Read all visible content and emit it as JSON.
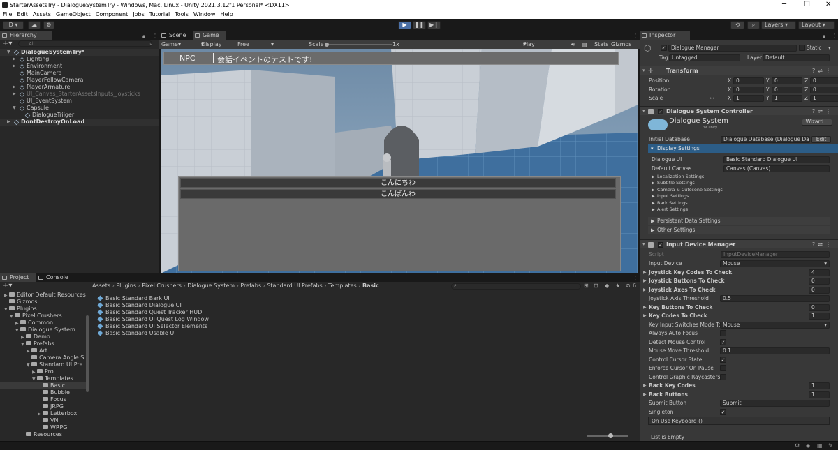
{
  "window": {
    "title": "StarterAssetsTry - DialogueSystemTry - Windows, Mac, Linux - Unity 2021.3.12f1 Personal* <DX11>",
    "minimize": "─",
    "maximize": "☐",
    "close": "✕"
  },
  "menu": [
    "File",
    "Edit",
    "Assets",
    "GameObject",
    "Component",
    "Jobs",
    "Tutorial",
    "Tools",
    "Window",
    "Help"
  ],
  "toolbar": {
    "account": "D ▾",
    "layers": "Layers",
    "layout": "Layout",
    "play": "▶",
    "pause": "❚❚",
    "step": "▶❙"
  },
  "hierarchy": {
    "tab": "Hierarchy",
    "search_placeholder": "All",
    "items": [
      {
        "label": "DialogueSystemTry*",
        "depth": 0,
        "type": "scene",
        "expanded": true
      },
      {
        "label": "Lighting",
        "depth": 1,
        "arrow": true
      },
      {
        "label": "Environment",
        "depth": 1,
        "arrow": true
      },
      {
        "label": "MainCamera",
        "depth": 1,
        "arrow": false
      },
      {
        "label": "PlayerFollowCamera",
        "depth": 1,
        "arrow": false
      },
      {
        "label": "PlayerArmature",
        "depth": 1,
        "arrow": true
      },
      {
        "label": "UI_Canvas_StarterAssetsInputs_Joysticks",
        "depth": 1,
        "arrow": true,
        "dim": true
      },
      {
        "label": "UI_EventSystem",
        "depth": 1,
        "arrow": false
      },
      {
        "label": "Capsule",
        "depth": 1,
        "arrow": true,
        "expanded": true
      },
      {
        "label": "DialogueTriiger",
        "depth": 2,
        "arrow": false
      },
      {
        "label": "DontDestroyOnLoad",
        "depth": 0,
        "type": "scene",
        "arrow": true
      }
    ]
  },
  "game": {
    "tabs": [
      {
        "label": "Scene"
      },
      {
        "label": "Game",
        "active": true
      }
    ],
    "mode": "Game",
    "display": "Display 1",
    "aspect": "Free Aspect",
    "scale_label": "Scale",
    "scale_value": "1x",
    "play_focused": "Play Focused",
    "stats": "Stats",
    "gizmos": "Gizmos",
    "subtitle_speaker": "NPC",
    "subtitle_text": "会話イベントのテストです!",
    "responses": [
      "こんにちわ",
      "こんばんわ"
    ]
  },
  "inspector": {
    "tab": "Inspector",
    "object_name": "Dialogue Manager",
    "static_label": "Static",
    "tag_label": "Tag",
    "tag_value": "Untagged",
    "layer_label": "Layer",
    "layer_value": "Default",
    "transform": {
      "title": "Transform",
      "position_label": "Position",
      "position": [
        "0",
        "0",
        "0"
      ],
      "rotation_label": "Rotation",
      "rotation": [
        "0",
        "0",
        "0"
      ],
      "scale_label": "Scale",
      "scale": [
        "1",
        "1",
        "1"
      ],
      "axes": [
        "X",
        "Y",
        "Z"
      ]
    },
    "dsc": {
      "title": "Dialogue System Controller",
      "logo_text": "Dialogue System",
      "logo_sub": "for unity",
      "wizard": "Wizard...",
      "initial_db_label": "Initial Database",
      "initial_db_value": "Dialogue Database (Dialogue Da",
      "edit": "Edit",
      "display_settings": "Display Settings",
      "dialogue_ui_label": "Dialogue UI",
      "dialogue_ui_value": "Basic Standard Dialogue UI",
      "default_canvas_label": "Default Canvas",
      "default_canvas_value": "Canvas (Canvas)",
      "subsections": [
        "Localization Settings",
        "Subtitle Settings",
        "Camera & Cutscene Settings",
        "Input Settings",
        "Bark Settings",
        "Alert Settings"
      ],
      "persistent": "Persistent Data Settings",
      "other": "Other Settings"
    },
    "idm": {
      "title": "Input Device Manager",
      "script_label": "Script",
      "script_value": "InputDeviceManager",
      "rows": [
        {
          "label": "Input Device",
          "value": "Mouse",
          "kind": "dropdown"
        },
        {
          "label": "Joystick Key Codes To Check",
          "value": "4",
          "kind": "count",
          "bold": true
        },
        {
          "label": "Joystick Buttons To Check",
          "value": "0",
          "kind": "count",
          "bold": true
        },
        {
          "label": "Joystick Axes To Check",
          "value": "0",
          "kind": "count",
          "bold": true
        },
        {
          "label": "Joystick Axis Threshold",
          "value": "0.5",
          "kind": "field"
        },
        {
          "label": "Key Buttons To Check",
          "value": "0",
          "kind": "count",
          "bold": true
        },
        {
          "label": "Key Codes To Check",
          "value": "1",
          "kind": "count",
          "bold": true
        },
        {
          "label": "Key Input Switches Mode To",
          "value": "Mouse",
          "kind": "dropdown"
        },
        {
          "label": "Always Auto Focus",
          "value": "",
          "kind": "check"
        },
        {
          "label": "Detect Mouse Control",
          "value": "✓",
          "kind": "check"
        },
        {
          "label": "Mouse Move Threshold",
          "value": "0.1",
          "kind": "field"
        },
        {
          "label": "Control Cursor State",
          "value": "✓",
          "kind": "check"
        },
        {
          "label": "Enforce Cursor On Pause",
          "value": "",
          "kind": "check"
        },
        {
          "label": "Control Graphic Raycasters",
          "value": "",
          "kind": "check"
        },
        {
          "label": "Back Key Codes",
          "value": "1",
          "kind": "count",
          "bold": true
        },
        {
          "label": "Back Buttons",
          "value": "1",
          "kind": "count",
          "bold": true
        },
        {
          "label": "Submit Button",
          "value": "Submit",
          "kind": "field"
        },
        {
          "label": "Singleton",
          "value": "✓",
          "kind": "check"
        }
      ],
      "event_label": "On Use Keyboard ()",
      "list_empty": "List is Empty"
    }
  },
  "project": {
    "tabs": [
      {
        "label": "Project",
        "active": true
      },
      {
        "label": "Console"
      }
    ],
    "breadcrumb": [
      "Assets",
      "Plugins",
      "Pixel Crushers",
      "Dialogue System",
      "Prefabs",
      "Standard UI Prefabs",
      "Templates",
      "Basic"
    ],
    "count_badge": "6",
    "tree": [
      {
        "label": "Database",
        "depth": 2,
        "arrow": false,
        "cut": true
      },
      {
        "label": "Editor Default Resources",
        "depth": 1,
        "arrow": true
      },
      {
        "label": "Gizmos",
        "depth": 1,
        "arrow": false
      },
      {
        "label": "Plugins",
        "depth": 1,
        "arrow": true,
        "open": true
      },
      {
        "label": "Pixel Crushers",
        "depth": 2,
        "arrow": true,
        "open": true
      },
      {
        "label": "Common",
        "depth": 3,
        "arrow": true
      },
      {
        "label": "Dialogue System",
        "depth": 3,
        "arrow": true,
        "open": true
      },
      {
        "label": "Demo",
        "depth": 4,
        "arrow": true
      },
      {
        "label": "Prefabs",
        "depth": 4,
        "arrow": true,
        "open": true
      },
      {
        "label": "Art",
        "depth": 5,
        "arrow": true
      },
      {
        "label": "Camera Angle S",
        "depth": 5,
        "arrow": false
      },
      {
        "label": "Standard UI Pre",
        "depth": 5,
        "arrow": true,
        "open": true
      },
      {
        "label": "Pro",
        "depth": 6,
        "arrow": true
      },
      {
        "label": "Templates",
        "depth": 6,
        "arrow": true,
        "open": true
      },
      {
        "label": "Basic",
        "depth": 7,
        "arrow": false,
        "selected": true
      },
      {
        "label": "Bubble",
        "depth": 7,
        "arrow": false
      },
      {
        "label": "Focus",
        "depth": 7,
        "arrow": false
      },
      {
        "label": "JRPG",
        "depth": 7,
        "arrow": false
      },
      {
        "label": "Letterbox",
        "depth": 7,
        "arrow": true
      },
      {
        "label": "VN",
        "depth": 7,
        "arrow": false
      },
      {
        "label": "WRPG",
        "depth": 7,
        "arrow": false
      },
      {
        "label": "Resources",
        "depth": 4,
        "arrow": false
      }
    ],
    "files": [
      "Basic Standard Bark UI",
      "Basic Standard Dialogue UI",
      "Basic Standard Quest Tracker HUD",
      "Basic Standard UI Quest Log Window",
      "Basic Standard UI Selector Elements",
      "Basic Standard Usable UI"
    ]
  }
}
